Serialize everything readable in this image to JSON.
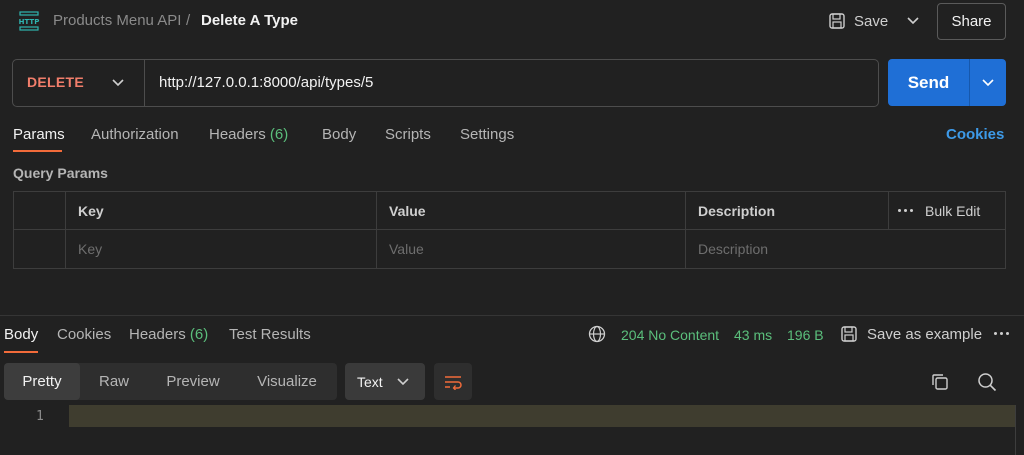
{
  "header": {
    "icon_text": "HTTP",
    "collection": "Products Menu API",
    "separator": "/",
    "request_name": "Delete A Type",
    "save_label": "Save",
    "share_label": "Share"
  },
  "request": {
    "method": "DELETE",
    "url": "http://127.0.0.1:8000/api/types/5",
    "send_label": "Send"
  },
  "request_tabs": [
    {
      "label": "Params",
      "count": ""
    },
    {
      "label": "Authorization",
      "count": ""
    },
    {
      "label": "Headers",
      "count": "(6)"
    },
    {
      "label": "Body",
      "count": ""
    },
    {
      "label": "Scripts",
      "count": ""
    },
    {
      "label": "Settings",
      "count": ""
    }
  ],
  "cookies_link": "Cookies",
  "query_params": {
    "title": "Query Params",
    "columns": [
      "Key",
      "Value",
      "Description"
    ],
    "bulk_edit": "Bulk Edit",
    "placeholders": [
      "Key",
      "Value",
      "Description"
    ]
  },
  "response": {
    "tabs": [
      {
        "label": "Body",
        "count": ""
      },
      {
        "label": "Cookies",
        "count": ""
      },
      {
        "label": "Headers",
        "count": "(6)"
      },
      {
        "label": "Test Results",
        "count": ""
      }
    ],
    "status": "204 No Content",
    "time": "43 ms",
    "size": "196 B",
    "save_example": "Save as example",
    "views": [
      "Pretty",
      "Raw",
      "Preview",
      "Visualize"
    ],
    "format": "Text",
    "line_number": "1"
  },
  "colors": {
    "method_delete": "#f27e6b",
    "accent_tab": "#f26b3a",
    "send_blue": "#1f6fd6",
    "status_green": "#5bbf7c",
    "link_blue": "#3d9ae8"
  }
}
